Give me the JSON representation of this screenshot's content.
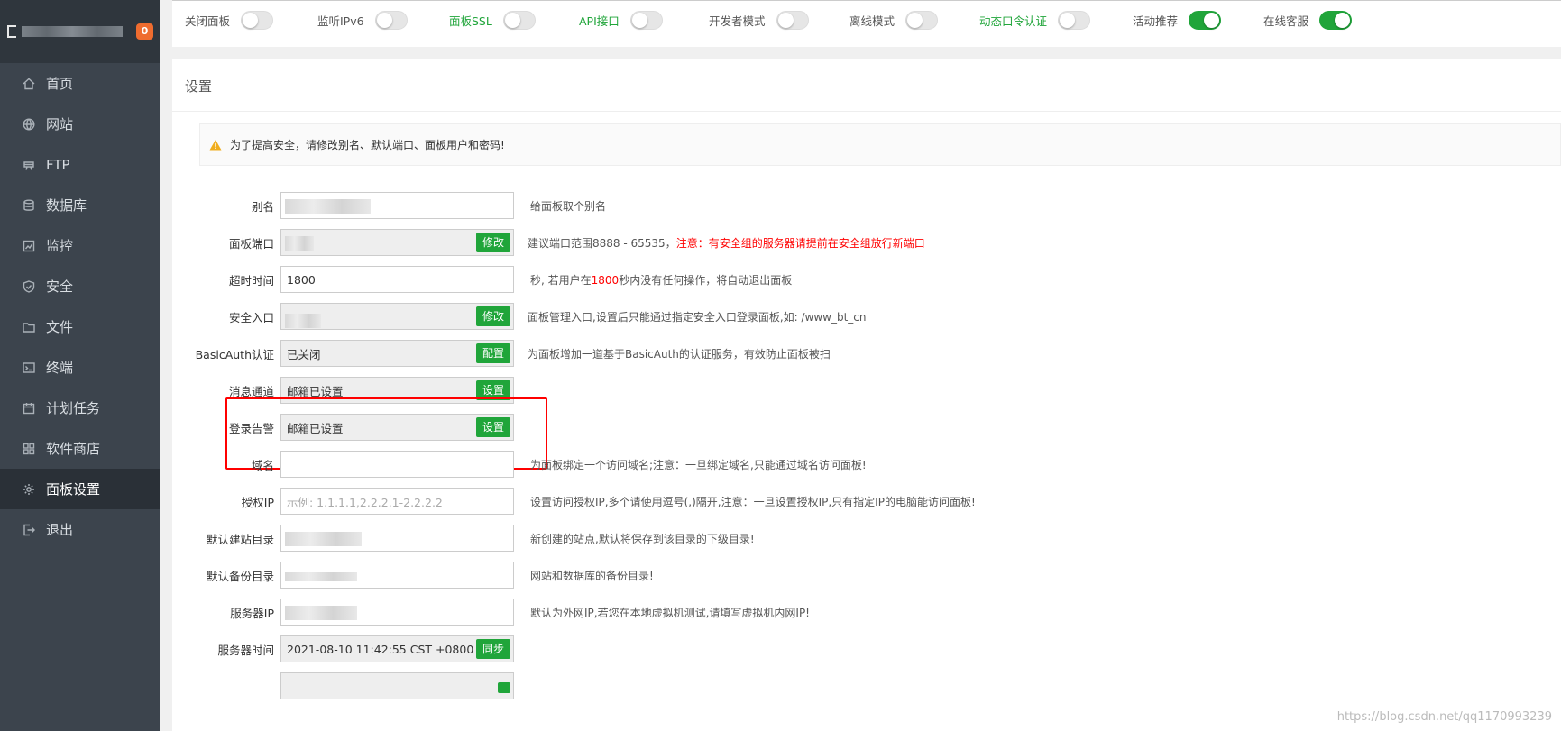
{
  "sidebar": {
    "badge": "0",
    "items": [
      {
        "label": "首页",
        "icon": "home-icon"
      },
      {
        "label": "网站",
        "icon": "globe-icon"
      },
      {
        "label": "FTP",
        "icon": "ftp-icon"
      },
      {
        "label": "数据库",
        "icon": "database-icon"
      },
      {
        "label": "监控",
        "icon": "monitor-icon"
      },
      {
        "label": "安全",
        "icon": "shield-icon"
      },
      {
        "label": "文件",
        "icon": "folder-icon"
      },
      {
        "label": "终端",
        "icon": "terminal-icon"
      },
      {
        "label": "计划任务",
        "icon": "calendar-icon"
      },
      {
        "label": "软件商店",
        "icon": "apps-icon"
      },
      {
        "label": "面板设置",
        "icon": "gear-icon"
      },
      {
        "label": "退出",
        "icon": "logout-icon"
      }
    ],
    "active_index": 10
  },
  "toggles": [
    {
      "label": "关闭面板",
      "on": false,
      "green": false
    },
    {
      "label": "监听IPv6",
      "on": false,
      "green": false
    },
    {
      "label": "面板SSL",
      "on": false,
      "green": true
    },
    {
      "label": "API接口",
      "on": false,
      "green": true
    },
    {
      "label": "开发者模式",
      "on": false,
      "green": false
    },
    {
      "label": "离线模式",
      "on": false,
      "green": false
    },
    {
      "label": "动态口令认证",
      "on": false,
      "green": true
    },
    {
      "label": "活动推荐",
      "on": true,
      "green": false
    },
    {
      "label": "在线客服",
      "on": true,
      "green": false
    }
  ],
  "panel": {
    "title": "设置",
    "alert": "为了提高安全，请修改别名、默认端口、面板用户和密码!"
  },
  "rows": [
    {
      "label": "别名",
      "value": "",
      "masked": true,
      "hint": "给面板取个别名"
    },
    {
      "label": "面板端口",
      "value": "",
      "masked": true,
      "button": "修改",
      "hint": "建议端口范围8888 - 65535，",
      "hint_red": "注意：有安全组的服务器请提前在安全组放行新端口"
    },
    {
      "label": "超时时间",
      "value": "1800",
      "hint_pre": "秒, 若用户在",
      "hint_red": "1800",
      "hint_post": "秒内没有任何操作，将自动退出面板"
    },
    {
      "label": "安全入口",
      "value": "",
      "masked": true,
      "button": "修改",
      "hint": "面板管理入口,设置后只能通过指定安全入口登录面板,如: /www_bt_cn"
    },
    {
      "label": "BasicAuth认证",
      "value": "已关闭",
      "button": "配置",
      "hint": "为面板增加一道基于BasicAuth的认证服务，有效防止面板被扫"
    },
    {
      "label": "消息通道",
      "value": "邮箱已设置",
      "button": "设置",
      "hint": ""
    },
    {
      "label": "登录告警",
      "value": "邮箱已设置",
      "button": "设置",
      "hint": ""
    },
    {
      "label": "域名",
      "value": "",
      "hint": "为面板绑定一个访问域名;注意：一旦绑定域名,只能通过域名访问面板!"
    },
    {
      "label": "授权IP",
      "placeholder": "示例: 1.1.1.1,2.2.2.1-2.2.2.2",
      "hint": "设置访问授权IP,多个请使用逗号(,)隔开,注意：一旦设置授权IP,只有指定IP的电脑能访问面板!"
    },
    {
      "label": "默认建站目录",
      "value": "",
      "masked": true,
      "hint": "新创建的站点,默认将保存到该目录的下级目录!"
    },
    {
      "label": "默认备份目录",
      "value": "",
      "masked": true,
      "hint": "网站和数据库的备份目录!"
    },
    {
      "label": "服务器IP",
      "value": "",
      "masked": true,
      "hint": "默认为外网IP,若您在本地虚拟机测试,请填写虚拟机内网IP!"
    },
    {
      "label": "服务器时间",
      "value": "2021-08-10 11:42:55 CST +0800",
      "button": "同步",
      "hint": ""
    }
  ],
  "watermark": "https://blog.csdn.net/qq1170993239"
}
